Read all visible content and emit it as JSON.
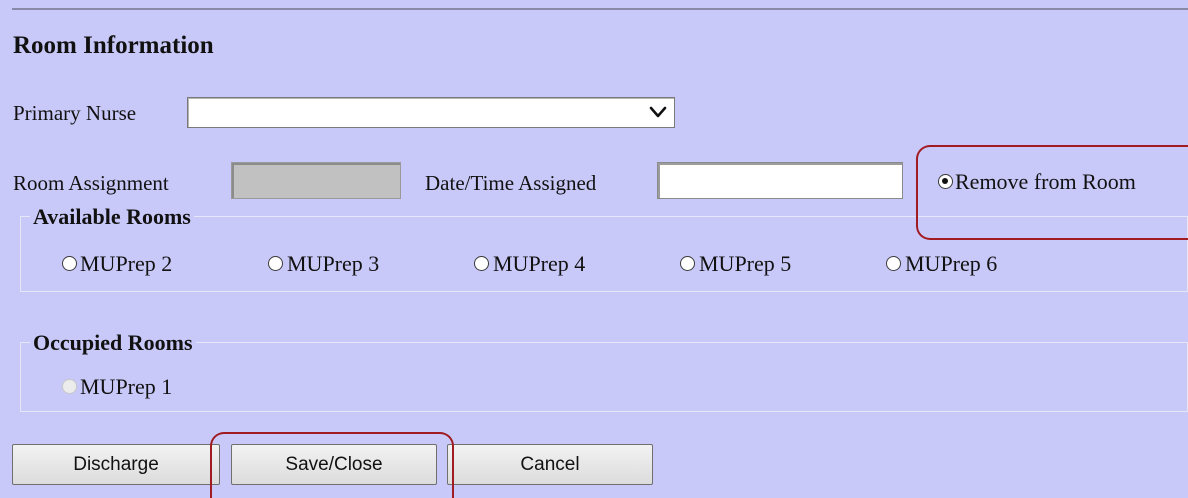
{
  "section_title": "Room Information",
  "primary_nurse": {
    "label": "Primary Nurse",
    "value": ""
  },
  "room_assignment": {
    "label": "Room Assignment",
    "value": ""
  },
  "date_time_assigned": {
    "label": "Date/Time Assigned",
    "value": ""
  },
  "remove_from_room": {
    "label": "Remove from Room",
    "checked": true
  },
  "available_rooms": {
    "legend": "Available Rooms",
    "rooms": [
      {
        "label": "MUPrep 2"
      },
      {
        "label": "MUPrep 3"
      },
      {
        "label": "MUPrep 4"
      },
      {
        "label": "MUPrep 5"
      },
      {
        "label": "MUPrep 6"
      }
    ]
  },
  "occupied_rooms": {
    "legend": "Occupied Rooms",
    "rooms": [
      {
        "label": "MUPrep 1",
        "disabled": true
      }
    ]
  },
  "buttons": {
    "discharge": "Discharge",
    "save_close": "Save/Close",
    "cancel": "Cancel"
  },
  "colors": {
    "background": "#c9c9f9",
    "highlight": "#a11b23"
  },
  "icons": {
    "select_chevron": "chevron-down-icon"
  }
}
